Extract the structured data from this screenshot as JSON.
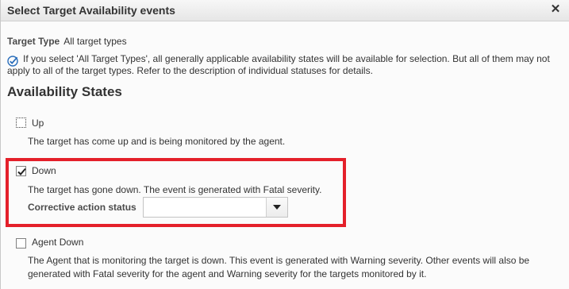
{
  "dialog": {
    "title": "Select Target Availability events",
    "close_glyph": "✕"
  },
  "target_type": {
    "label": "Target Type",
    "value": "All target types"
  },
  "info": {
    "icon": "check-circle-icon",
    "text": "If you select 'All Target Types', all generally applicable availability states will be available for selection. But all of them may not apply to all of the target types. Refer to the description of individual statuses for details."
  },
  "availability": {
    "heading": "Availability States",
    "states": [
      {
        "label": "Up",
        "checked": false,
        "description": "The target has come up and is being monitored by the agent."
      },
      {
        "label": "Down",
        "checked": true,
        "description": "The target has gone down. The event is generated with Fatal severity.",
        "corrective_label": "Corrective action status",
        "corrective_value": ""
      },
      {
        "label": "Agent Down",
        "checked": false,
        "description": "The Agent that is monitoring the target is down. This event is generated with Warning severity. Other events will also be generated with Fatal severity for the agent and Warning severity for the targets monitored by it."
      }
    ]
  },
  "colors": {
    "highlight": "#e4202a",
    "info_icon": "#2a6ebb"
  }
}
